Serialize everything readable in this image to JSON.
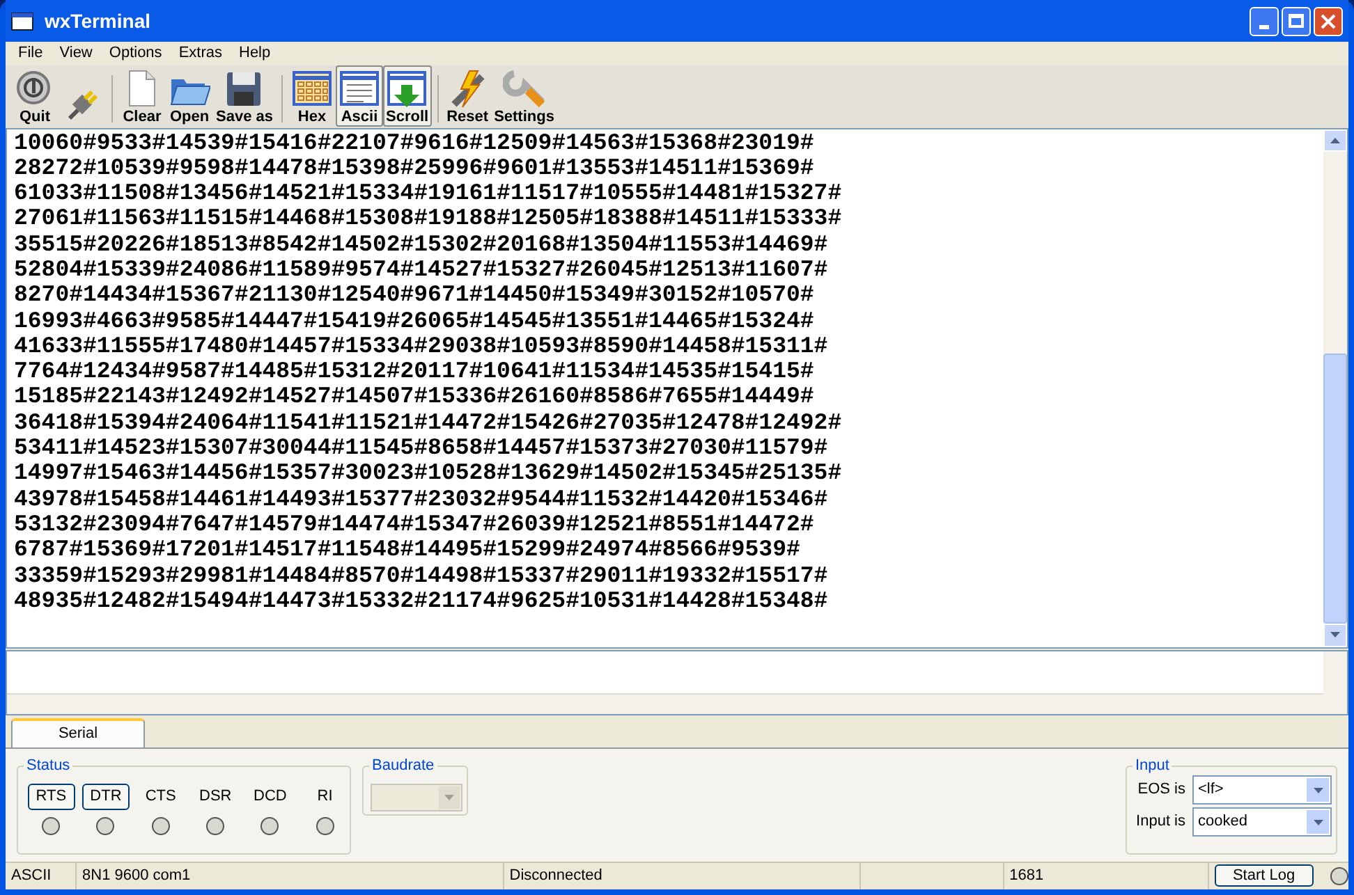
{
  "window": {
    "title": "wxTerminal"
  },
  "menu": [
    "File",
    "View",
    "Options",
    "Extras",
    "Help"
  ],
  "toolbar": [
    {
      "kind": "quit",
      "label": "Quit",
      "pressed": false
    },
    {
      "kind": "plug",
      "pressed": false
    },
    {
      "kind": "sep"
    },
    {
      "kind": "clear",
      "label": "Clear",
      "pressed": false
    },
    {
      "kind": "open",
      "label": "Open",
      "pressed": false
    },
    {
      "kind": "save",
      "label": "Save as",
      "pressed": false
    },
    {
      "kind": "sep"
    },
    {
      "kind": "hex",
      "label": "Hex",
      "pressed": false
    },
    {
      "kind": "ascii",
      "label": "Ascii",
      "pressed": true
    },
    {
      "kind": "scroll",
      "label": "Scroll",
      "pressed": true
    },
    {
      "kind": "sep"
    },
    {
      "kind": "reset",
      "label": "Reset",
      "pressed": false
    },
    {
      "kind": "settings",
      "label": "Settings",
      "pressed": false
    }
  ],
  "output_lines": [
    "10060#9533#14539#15416#22107#9616#12509#14563#15368#23019#",
    "28272#10539#9598#14478#15398#25996#9601#13553#14511#15369#",
    "61033#11508#13456#14521#15334#19161#11517#10555#14481#15327#",
    "27061#11563#11515#14468#15308#19188#12505#18388#14511#15333#",
    "35515#20226#18513#8542#14502#15302#20168#13504#11553#14469#",
    "52804#15339#24086#11589#9574#14527#15327#26045#12513#11607#",
    "8270#14434#15367#21130#12540#9671#14450#15349#30152#10570#",
    "16993#4663#9585#14447#15419#26065#14545#13551#14465#15324#",
    "41633#11555#17480#14457#15334#29038#10593#8590#14458#15311#",
    "7764#12434#9587#14485#15312#20117#10641#11534#14535#15415#",
    "15185#22143#12492#14527#14507#15336#26160#8586#7655#14449#",
    "36418#15394#24064#11541#11521#14472#15426#27035#12478#12492#",
    "53411#14523#15307#30044#11545#8658#14457#15373#27030#11579#",
    "14997#15463#14456#15357#30023#10528#13629#14502#15345#25135#",
    "43978#15458#14461#14493#15377#23032#9544#11532#14420#15346#",
    "53132#23094#7647#14579#14474#15347#26039#12521#8551#14472#",
    "6787#15369#17201#14517#11548#14495#15299#24974#8566#9539#",
    "33359#15293#29981#14484#8570#14498#15337#29011#19332#15517#",
    "48935#12482#15494#14473#15332#21174#9625#10531#14428#15348#"
  ],
  "tabs": [
    {
      "label": "Serial",
      "selected": true
    }
  ],
  "status_group": {
    "title": "Status",
    "signals": [
      {
        "kind": "button",
        "label": "RTS",
        "lit": false
      },
      {
        "kind": "button",
        "label": "DTR",
        "lit": false
      },
      {
        "kind": "label",
        "label": "CTS",
        "lit": false
      },
      {
        "kind": "label",
        "label": "DSR",
        "lit": false
      },
      {
        "kind": "label",
        "label": "DCD",
        "lit": false
      },
      {
        "kind": "label",
        "label": "RI",
        "lit": false
      }
    ]
  },
  "baudrate": {
    "title": "Baudrate",
    "disabled": true
  },
  "input_group": {
    "title": "Input",
    "fields": [
      {
        "label": "EOS is",
        "value": "<lf>"
      },
      {
        "label": "Input is",
        "value": "cooked"
      }
    ]
  },
  "status_bar": {
    "fields": [
      "ASCII",
      "8N1 9600 com1",
      "Disconnected",
      "1681"
    ],
    "button": "Start Log",
    "lit": false
  }
}
